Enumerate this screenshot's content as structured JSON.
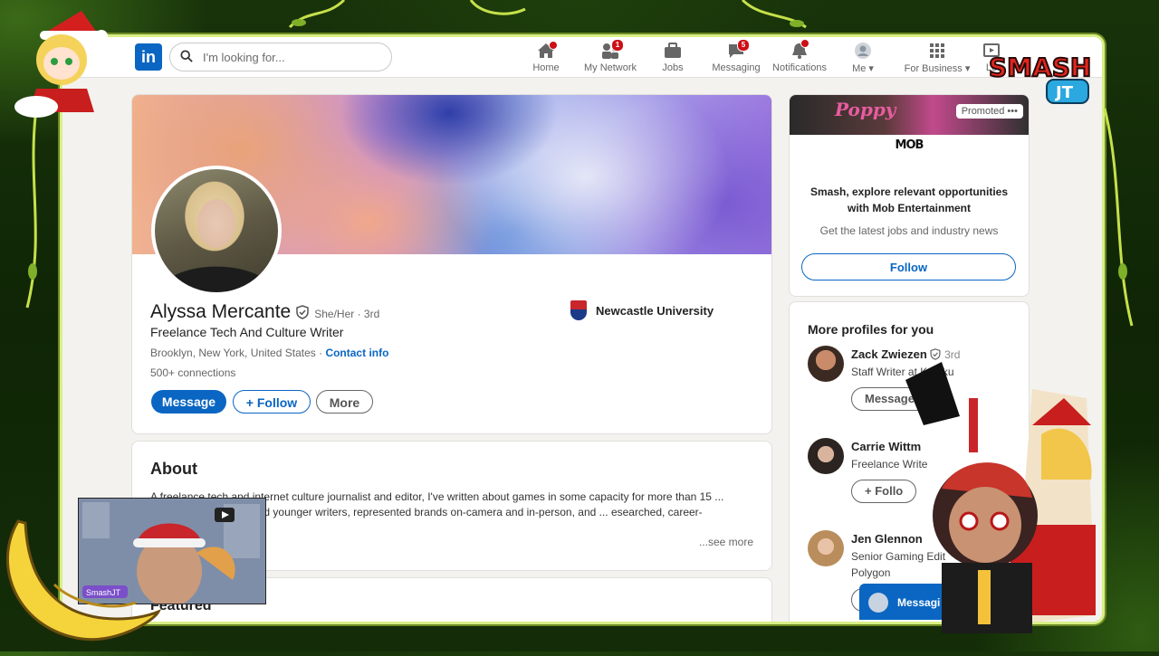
{
  "nav": {
    "search_placeholder": "I'm looking for...",
    "items": [
      {
        "label": "Home",
        "icon": "home-icon",
        "badge": null
      },
      {
        "label": "My Network",
        "icon": "network-icon",
        "badge": "1"
      },
      {
        "label": "Jobs",
        "icon": "briefcase-icon",
        "badge": null
      },
      {
        "label": "Messaging",
        "icon": "messaging-icon",
        "badge": "5"
      },
      {
        "label": "Notifications",
        "icon": "bell-icon",
        "badge": null
      },
      {
        "label": "Me ▾",
        "icon": "avatar-icon",
        "badge": null
      },
      {
        "label": "For Business ▾",
        "icon": "grid-icon",
        "badge": null
      },
      {
        "label": "Le",
        "icon": "learning-icon",
        "badge": null
      }
    ]
  },
  "profile": {
    "name": "Alyssa Mercante",
    "pronouns": "She/Her · 3rd",
    "headline": "Freelance Tech And Culture Writer",
    "location": "Brooklyn, New York, United States · ",
    "contact_info": "Contact info",
    "connections": "500+ connections",
    "university": "Newcastle University",
    "buttons": {
      "message": "Message",
      "follow": "+ Follow",
      "more": "More"
    }
  },
  "about": {
    "title": "About",
    "text": "A freelance tech and internet culture journalist and editor, I've written about games in some capacity for more than 15 ... lance budgets, mentored younger writers, represented brands on-camera and in-person, and ... esearched, career-defining reports.",
    "see_more": "...see more"
  },
  "featured": {
    "title": "Featured"
  },
  "promo": {
    "banner_text": "Poppy",
    "promoted": "Promoted •••",
    "logo": "MOB",
    "headline": "Smash, explore relevant opportunities with Mob Entertainment",
    "sub": "Get the latest jobs and industry news",
    "follow": "Follow"
  },
  "more_profiles": {
    "title": "More profiles for you",
    "people": [
      {
        "name": "Zack Zwiezen",
        "degree": "3rd",
        "subtitle": "Staff Writer at Kotaku",
        "button": "Message"
      },
      {
        "name": "Carrie Wittm",
        "degree": "",
        "subtitle": "Freelance Write",
        "button": "+ Follo"
      },
      {
        "name": "Jen Glennon",
        "degree": "",
        "subtitle": "Senior Gaming Edit",
        "subtitle2": "Polygon",
        "button": ""
      }
    ]
  },
  "messaging_bar": {
    "label": "Messagi"
  },
  "stream_overlay": {
    "logo_text": "SMASH",
    "logo_sub": "JT",
    "cam_label": "SmashJT"
  },
  "colors": {
    "brand": "#0a66c2",
    "frame": "#d8ef86"
  }
}
